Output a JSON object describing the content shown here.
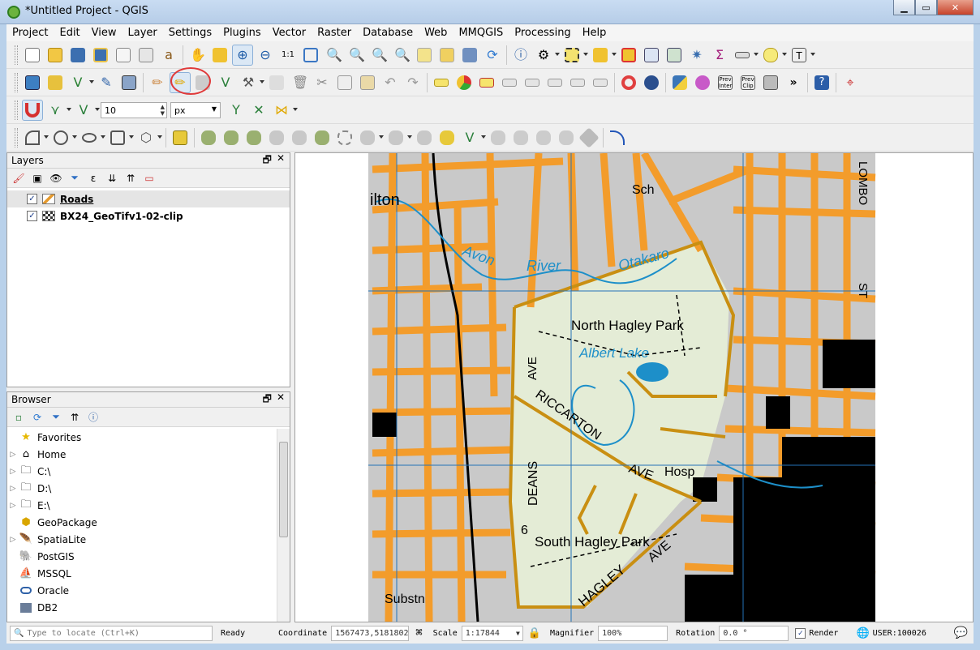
{
  "window": {
    "title": "*Untitled Project - QGIS"
  },
  "menu": [
    "Project",
    "Edit",
    "View",
    "Layer",
    "Settings",
    "Plugins",
    "Vector",
    "Raster",
    "Database",
    "Web",
    "MMQGIS",
    "Processing",
    "Help"
  ],
  "snapping": {
    "tolerance": "10",
    "unit": "px"
  },
  "toolbar_text": {
    "prev_inter": "Prev Inter",
    "prev_clip": "Prev Clip",
    "more": "»"
  },
  "layers_panel": {
    "title": "Layers",
    "items": [
      {
        "name": "Roads",
        "checked": true,
        "selected": true
      },
      {
        "name": "BX24_GeoTifv1-02-clip",
        "checked": true,
        "selected": false
      }
    ]
  },
  "browser_panel": {
    "title": "Browser",
    "items": [
      {
        "label": "Favorites",
        "icon": "star-icon",
        "expandable": false
      },
      {
        "label": "Home",
        "icon": "home-folder-icon",
        "expandable": true
      },
      {
        "label": "C:\\",
        "icon": "folder-icon",
        "expandable": true
      },
      {
        "label": "D:\\",
        "icon": "folder-icon",
        "expandable": true
      },
      {
        "label": "E:\\",
        "icon": "folder-icon",
        "expandable": true
      },
      {
        "label": "GeoPackage",
        "icon": "geopackage-icon",
        "expandable": false
      },
      {
        "label": "SpatiaLite",
        "icon": "spatialite-icon",
        "expandable": true
      },
      {
        "label": "PostGIS",
        "icon": "postgis-icon",
        "expandable": false
      },
      {
        "label": "MSSQL",
        "icon": "mssql-icon",
        "expandable": false
      },
      {
        "label": "Oracle",
        "icon": "oracle-icon",
        "expandable": false
      },
      {
        "label": "DB2",
        "icon": "db2-icon",
        "expandable": false
      }
    ]
  },
  "map_labels": {
    "ilton": "ilton",
    "sch": "Sch",
    "avon": "Avon",
    "river": "River",
    "otakaro": "Otakaro",
    "north_hagley": "North Hagley Park",
    "albert_lake": "Albert Lake",
    "ave": "AVE",
    "riccarton": "RICCARTON",
    "ave2": "AVE",
    "hosp": "Hosp",
    "deans": "DEANS",
    "six": "6",
    "south_hagley": "South Hagley Park",
    "ave3": "AVE",
    "hagley": "HAGLEY",
    "substn": "Substn",
    "lombo": "LOMBO",
    "st": "ST"
  },
  "status": {
    "locate_placeholder": "Type to locate (Ctrl+K)",
    "ready": "Ready",
    "coordinate_label": "Coordinate",
    "coordinate": "1567473,5181802",
    "scale_label": "Scale",
    "scale": "1:17844",
    "magnifier_label": "Magnifier",
    "magnifier": "100%",
    "rotation_label": "Rotation",
    "rotation": "0.0 °",
    "render_label": "Render",
    "crs": "USER:100026"
  },
  "colors": {
    "road": "#f39c2b",
    "park": "#dfe8cf",
    "water": "#1d8fc9",
    "highlight_road": "#d4a21c",
    "annotation": "#e03a3a"
  }
}
